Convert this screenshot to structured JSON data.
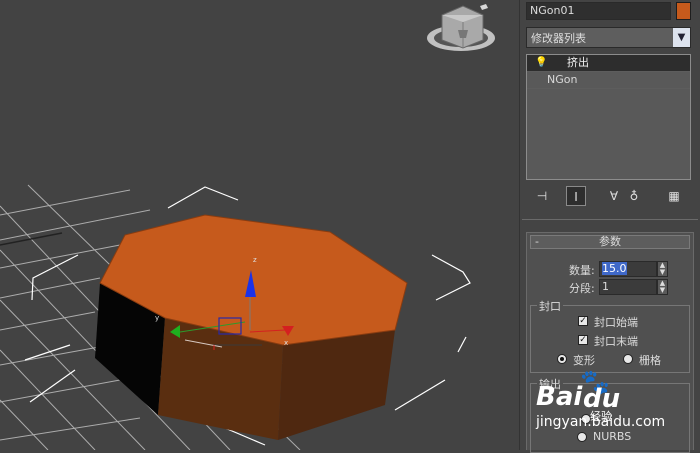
{
  "viewport": {
    "object_color": "#c65a1c",
    "grid_color": "#d8d8d8",
    "viewcube_icon": "viewcube-icon"
  },
  "panel": {
    "object_name": "NGon01",
    "object_color": "#c65a1c",
    "modifier_list": "修改器列表",
    "stack": [
      {
        "label": "挤出",
        "selected": true,
        "icon": "lightbulb-icon"
      },
      {
        "label": "NGon",
        "selected": false
      }
    ],
    "toolbar_icons": [
      "pin-stack-icon",
      "show-end-result-icon",
      "make-unique-icon",
      "remove-modifier-icon",
      "configure-modifier-sets-icon"
    ],
    "params": {
      "title": "参数",
      "collapse": "-",
      "amount_label": "数量:",
      "amount_value": "15.0",
      "segments_label": "分段:",
      "segments_value": "1",
      "capping": {
        "title": "封口",
        "cap_start": "封口始端",
        "cap_end": "封口末端",
        "morph": "变形",
        "grid": "栅格"
      },
      "output": {
        "title": "输出",
        "nurbs": "NURBS"
      }
    }
  },
  "watermark": {
    "brand": "Bai",
    "paw": "🐾",
    "du": "du",
    "sub": "经验",
    "site": "jingyan.baidu.com"
  }
}
